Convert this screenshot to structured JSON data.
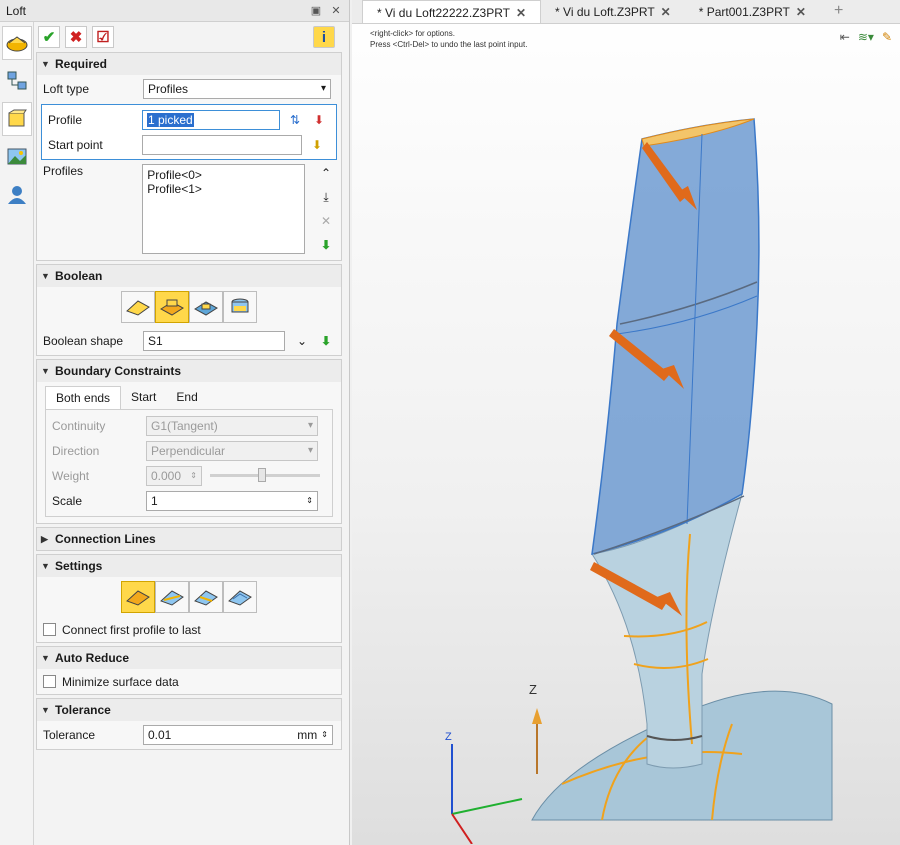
{
  "window": {
    "title": "Loft"
  },
  "toolbar": {
    "ok": "✔",
    "cancel": "✖",
    "apply": "☑",
    "info": "i"
  },
  "required": {
    "header": "Required",
    "loft_type_label": "Loft type",
    "loft_type_value": "Profiles",
    "profile_label": "Profile",
    "profile_value": "1 picked",
    "start_point_label": "Start point",
    "start_point_value": "",
    "profiles_label": "Profiles",
    "profiles_list": [
      "Profile<0>",
      "Profile<1>"
    ]
  },
  "boolean": {
    "header": "Boolean",
    "shape_label": "Boolean shape",
    "shape_value": "S1"
  },
  "boundary": {
    "header": "Boundary Constraints",
    "tabs": [
      "Both ends",
      "Start",
      "End"
    ],
    "continuity_label": "Continuity",
    "continuity_value": "G1(Tangent)",
    "direction_label": "Direction",
    "direction_value": "Perpendicular",
    "weight_label": "Weight",
    "weight_value": "0.000",
    "scale_label": "Scale",
    "scale_value": "1"
  },
  "connection": {
    "header": "Connection Lines"
  },
  "settings": {
    "header": "Settings",
    "connect_label": "Connect first profile to last"
  },
  "auto_reduce": {
    "header": "Auto Reduce",
    "minimize_label": "Minimize surface data"
  },
  "tolerance": {
    "header": "Tolerance",
    "label": "Tolerance",
    "value": "0.01",
    "unit": "mm"
  },
  "doc_tabs": [
    "* Vi du Loft22222.Z3PRT",
    "* Vi du Loft.Z3PRT",
    "* Part001.Z3PRT"
  ],
  "hint": {
    "line1": "<right-click> for options.",
    "line2": "Press <Ctrl-Del> to undo the last point input."
  },
  "axis": {
    "z": "Z"
  },
  "colors": {
    "accent": "#ffd84a",
    "surface_blue": "#6f9bd1",
    "arrow": "#e06a1b",
    "curve": "#f0a21c"
  }
}
